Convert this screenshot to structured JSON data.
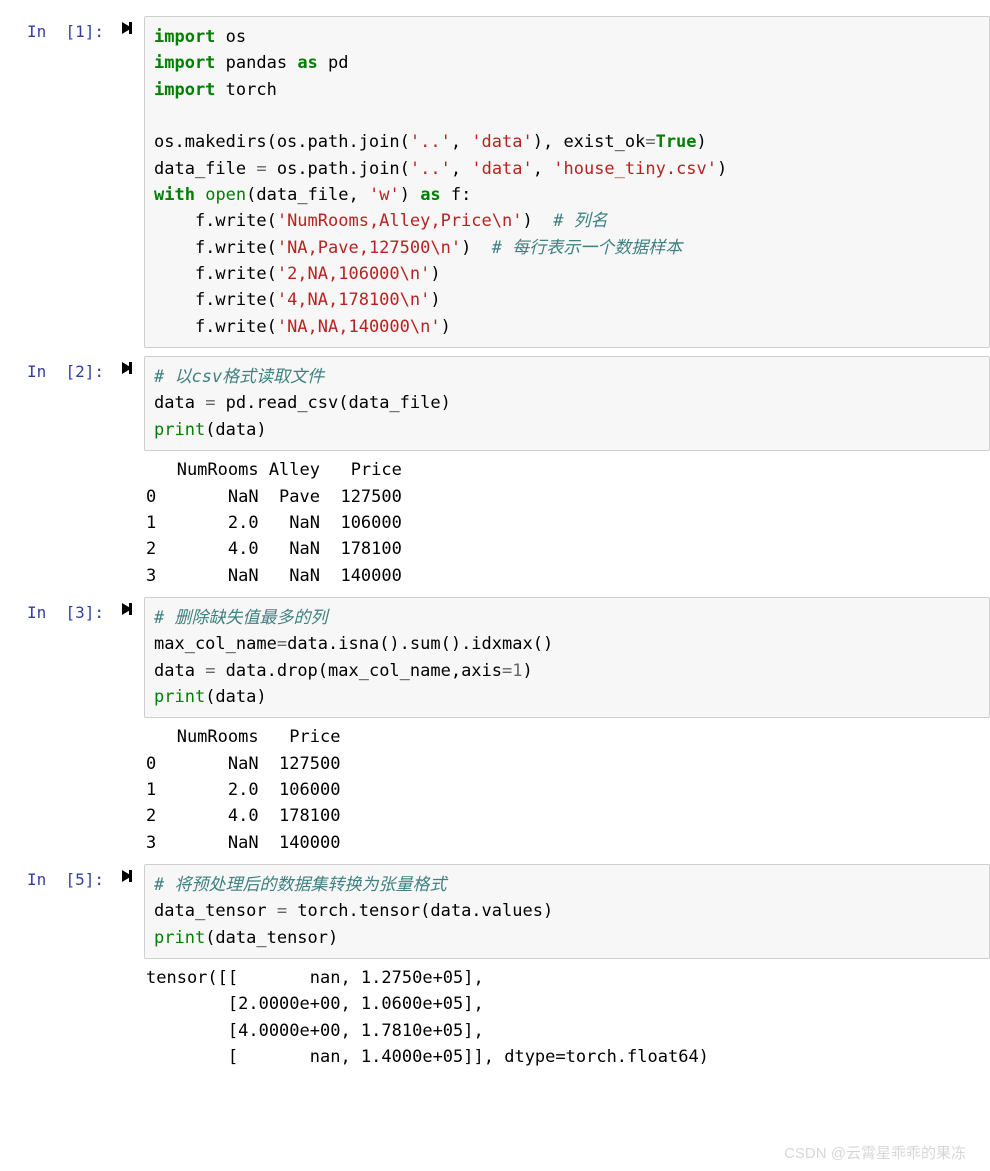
{
  "cells": [
    {
      "prompt": "In  [1]:",
      "code_html": "<span class=\"k-keyword\">import</span> os\n<span class=\"k-keyword\">import</span> pandas <span class=\"k-keyword\">as</span> pd\n<span class=\"k-keyword\">import</span> torch\n\nos.makedirs(os.path.join(<span class=\"k-str\">'..'</span>, <span class=\"k-str\">'data'</span>), exist_ok<span class=\"k-op\">=</span><span class=\"k-const\">True</span>)\ndata_file <span class=\"k-op\">=</span> os.path.join(<span class=\"k-str\">'..'</span>, <span class=\"k-str\">'data'</span>, <span class=\"k-str\">'house_tiny.csv'</span>)\n<span class=\"k-keyword\">with</span> <span class=\"k-builtin\">open</span>(data_file, <span class=\"k-str\">'w'</span>) <span class=\"k-keyword\">as</span> f:\n    f.write(<span class=\"k-str\">'NumRooms,Alley,Price\\n'</span>)  <span class=\"k-comment\"># 列名</span>\n    f.write(<span class=\"k-str\">'NA,Pave,127500\\n'</span>)  <span class=\"k-comment\"># 每行表示一个数据样本</span>\n    f.write(<span class=\"k-str\">'2,NA,106000\\n'</span>)\n    f.write(<span class=\"k-str\">'4,NA,178100\\n'</span>)\n    f.write(<span class=\"k-str\">'NA,NA,140000\\n'</span>)",
      "output": ""
    },
    {
      "prompt": "In  [2]:",
      "code_html": "<span class=\"k-comment\"># 以csv格式读取文件</span>\ndata <span class=\"k-op\">=</span> pd.read_csv(data_file)\n<span class=\"k-builtin\">print</span>(data)",
      "output": "   NumRooms Alley   Price\n0       NaN  Pave  127500\n1       2.0   NaN  106000\n2       4.0   NaN  178100\n3       NaN   NaN  140000"
    },
    {
      "prompt": "In  [3]:",
      "code_html": "<span class=\"k-comment\"># 删除缺失值最多的列</span>\nmax_col_name<span class=\"k-op\">=</span>data.isna().sum().idxmax()\ndata <span class=\"k-op\">=</span> data.drop(max_col_name,axis<span class=\"k-op\">=</span><span class=\"k-num\">1</span>)\n<span class=\"k-builtin\">print</span>(data)",
      "output": "   NumRooms   Price\n0       NaN  127500\n1       2.0  106000\n2       4.0  178100\n3       NaN  140000"
    },
    {
      "prompt": "In  [5]:",
      "code_html": "<span class=\"k-comment\"># 将预处理后的数据集转换为张量格式</span>\ndata_tensor <span class=\"k-op\">=</span> torch.tensor(data.values)\n<span class=\"k-builtin\">print</span>(data_tensor)",
      "output": "tensor([[       nan, 1.2750e+05],\n        [2.0000e+00, 1.0600e+05],\n        [4.0000e+00, 1.7810e+05],\n        [       nan, 1.4000e+05]], dtype=torch.float64)"
    }
  ],
  "run_btn_title": "Run cell",
  "watermark": "CSDN @云霄星乖乖的果冻"
}
